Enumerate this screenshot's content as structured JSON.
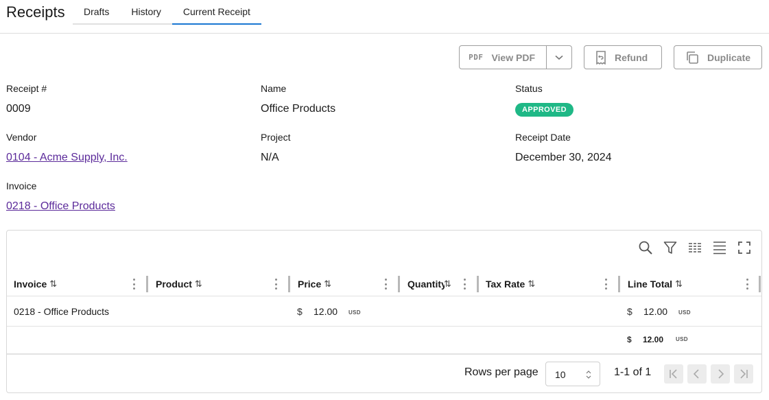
{
  "header": {
    "title": "Receipts",
    "tabs": [
      {
        "label": "Drafts"
      },
      {
        "label": "History"
      },
      {
        "label": "Current Receipt"
      }
    ]
  },
  "actions": {
    "pdf_tag": "PDF",
    "view_pdf": "View PDF",
    "refund": "Refund",
    "duplicate": "Duplicate"
  },
  "receipt": {
    "number_label": "Receipt #",
    "number": "0009",
    "name_label": "Name",
    "name": "Office Products",
    "status_label": "Status",
    "status": "APPROVED",
    "vendor_label": "Vendor",
    "vendor": "0104 - Acme Supply, Inc.",
    "project_label": "Project",
    "project": "N/A",
    "date_label": "Receipt Date",
    "date": "December 30, 2024",
    "invoice_label": "Invoice",
    "invoice": "0218 - Office Products"
  },
  "table": {
    "columns": [
      {
        "label": "Invoice"
      },
      {
        "label": "Product"
      },
      {
        "label": "Price"
      },
      {
        "label": "Quantity"
      },
      {
        "label": "Tax Rate"
      },
      {
        "label": "Line Total"
      }
    ],
    "rows": [
      {
        "invoice": "0218 - Office Products",
        "product": "",
        "price_symbol": "$",
        "price": "12.00",
        "price_unit": "USD",
        "quantity": "",
        "tax_rate": "",
        "total_symbol": "$",
        "total": "12.00",
        "total_unit": "USD"
      }
    ],
    "summary": {
      "total_symbol": "$",
      "total": "12.00",
      "total_unit": "USD"
    },
    "footer": {
      "rows_per_page_label": "Rows per page",
      "rows_per_page": "10",
      "range": "1-1 of 1"
    }
  },
  "colors": {
    "accent": "#1976d2",
    "status_approved": "#1fb886",
    "link": "#5b2a9a"
  },
  "icons": [
    "chevron-down-icon",
    "receipt-refund-icon",
    "copy-icon",
    "search-icon",
    "filter-icon",
    "columns-icon",
    "density-icon",
    "fullscreen-icon",
    "sort-icon",
    "first-page-icon",
    "prev-page-icon",
    "next-page-icon",
    "last-page-icon"
  ]
}
